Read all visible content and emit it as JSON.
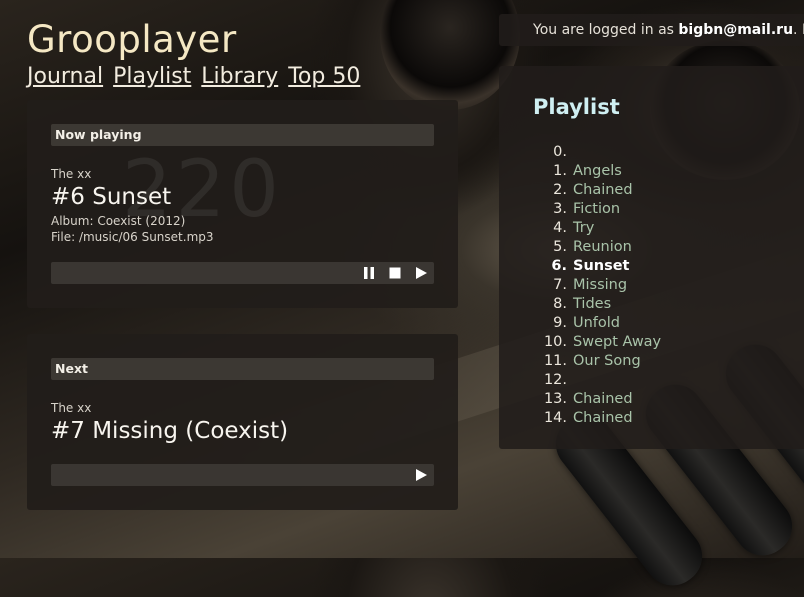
{
  "app": {
    "title": "Grooplayer"
  },
  "nav": {
    "items": [
      "Journal",
      "Playlist",
      "Library",
      "Top 50"
    ]
  },
  "now_playing": {
    "header": "Now playing",
    "artist": "The xx",
    "title": "#6 Sunset",
    "album": "Album: Coexist (2012)",
    "file": "File: /music/06 Sunset.mp3",
    "watermark": "220"
  },
  "next": {
    "header": "Next",
    "artist": "The xx",
    "title": "#7 Missing (Coexist)"
  },
  "login": {
    "prefix": "You are logged in as",
    "user": "bigbn@mail.ru",
    "suffix": ". L"
  },
  "playlist": {
    "title": "Playlist",
    "current_index": 6,
    "items": [
      {
        "num": "0.",
        "name": ""
      },
      {
        "num": "1.",
        "name": "Angels"
      },
      {
        "num": "2.",
        "name": "Chained"
      },
      {
        "num": "3.",
        "name": "Fiction"
      },
      {
        "num": "4.",
        "name": "Try"
      },
      {
        "num": "5.",
        "name": "Reunion"
      },
      {
        "num": "6.",
        "name": "Sunset"
      },
      {
        "num": "7.",
        "name": "Missing"
      },
      {
        "num": "8.",
        "name": "Tides"
      },
      {
        "num": "9.",
        "name": "Unfold"
      },
      {
        "num": "10.",
        "name": "Swept Away"
      },
      {
        "num": "11.",
        "name": "Our Song"
      },
      {
        "num": "12.",
        "name": ""
      },
      {
        "num": "13.",
        "name": "Chained"
      },
      {
        "num": "14.",
        "name": "Chained"
      }
    ]
  },
  "icons": {
    "pause": "pause-icon",
    "stop": "stop-icon",
    "play": "play-icon"
  }
}
